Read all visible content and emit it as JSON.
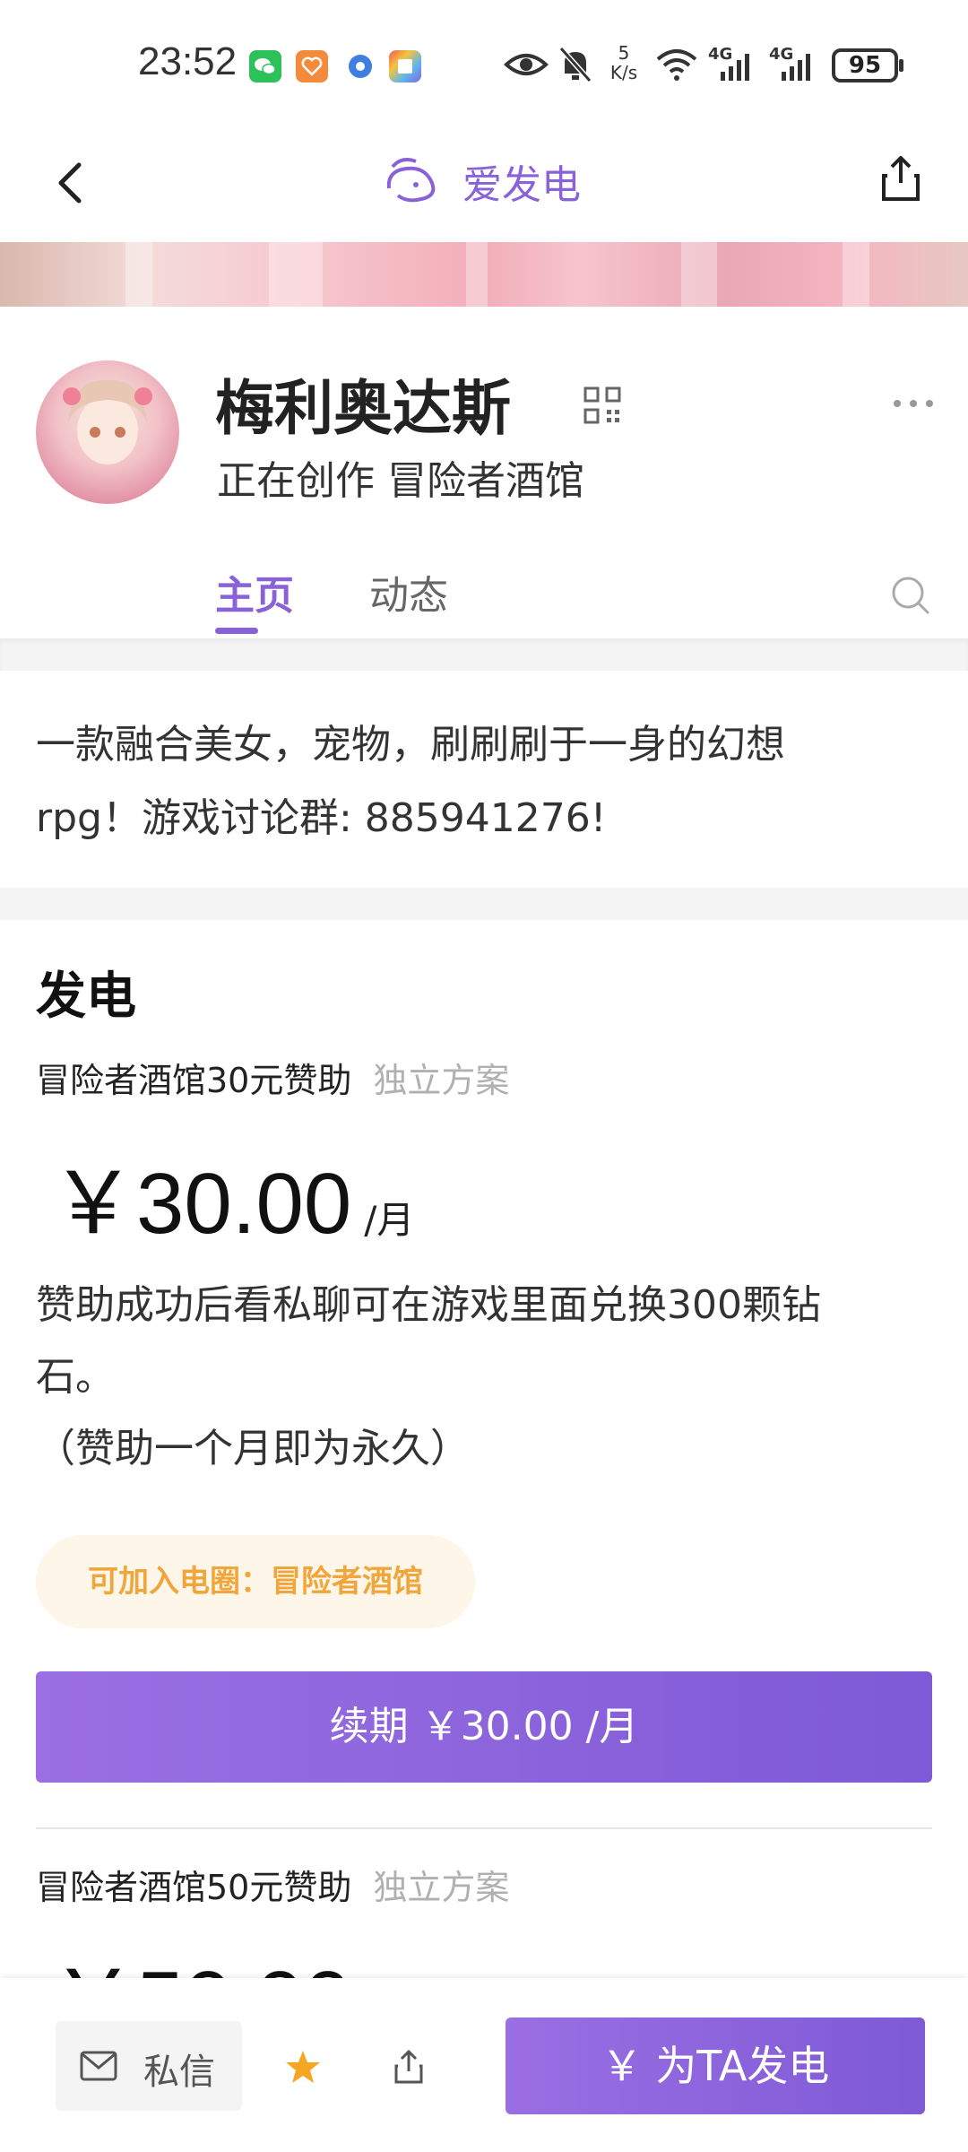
{
  "status_bar": {
    "time": "23:52",
    "net_speed_value": "5",
    "net_speed_unit": "K/s",
    "network_1": "4G",
    "network_2": "4G",
    "battery": "95"
  },
  "header": {
    "title": "爱发电",
    "icons": [
      "back-arrow-icon",
      "logo-icon",
      "share-icon"
    ]
  },
  "profile": {
    "name": "梅利奥达斯",
    "subtitle": "正在创作 冒险者酒馆",
    "tabs": [
      {
        "label": "主页",
        "active": true
      },
      {
        "label": "动态",
        "active": false
      }
    ]
  },
  "description": {
    "line1": "一款融合美女，宠物，刷刷刷于一身的幻想",
    "line2": "rpg！游戏讨论群: 885941276!"
  },
  "section": {
    "title": "发电"
  },
  "plans": [
    {
      "name": "冒险者酒馆30元赞助",
      "tag": "独立方案",
      "price": "￥30.00",
      "unit": "/月",
      "desc_line1": "赞助成功后看私聊可在游戏里面兑换300颗钻",
      "desc_line2": "石。",
      "desc_line3": "（赞助一个月即为永久）",
      "circle_pill": "可加入电圈：冒险者酒馆",
      "renew_button": "续期 ￥30.00 /月"
    },
    {
      "name": "冒险者酒馆50元赞助",
      "tag": "独立方案",
      "price": "￥50.00"
    }
  ],
  "bottom_bar": {
    "dm_label": "私信",
    "fund_button": "￥  为TA发电"
  },
  "colors": {
    "accent": "#8a62d8",
    "pill_text": "#f0a63b",
    "pill_bg": "#fff6ea",
    "star": "#f5a623"
  }
}
